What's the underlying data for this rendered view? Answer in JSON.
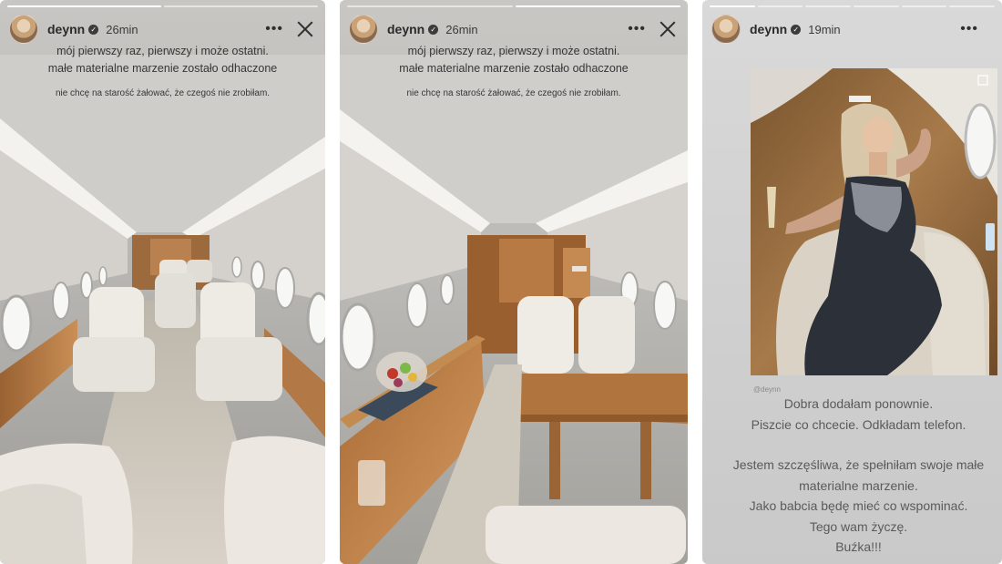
{
  "stories": [
    {
      "username": "deynn",
      "time": "26min",
      "caption_lines": [
        "mój pierwszy raz, pierwszy i może ostatni.",
        "małe materialne marzenie zostało odhaczone"
      ],
      "sub_caption": "nie chcę na starość żałować, że czegoś nie zrobiłam.",
      "has_close": true
    },
    {
      "username": "deynn",
      "time": "26min",
      "caption_lines": [
        "mój pierwszy raz, pierwszy i może ostatni.",
        "małe materialne marzenie zostało odhaczone"
      ],
      "sub_caption": "nie chcę na starość żałować, że czegoś nie zrobiłam.",
      "has_close": true
    },
    {
      "username": "deynn",
      "time": "19min",
      "post_handle": "@deynn",
      "text_block_1": [
        "Dobra dodałam ponownie.",
        "Piszcie co chcecie. Odkładam telefon."
      ],
      "text_block_2": [
        "Jestem szczęśliwa, że spełniłam swoje małe",
        "materialne marzenie.",
        "Jako babcia będę mieć co wspominać.",
        "Tego wam życzę.",
        "Buźka!!!"
      ],
      "has_close": false
    }
  ],
  "icons": {
    "more": "more-horizontal-icon",
    "close": "close-icon",
    "verified": "verified-badge-icon"
  }
}
